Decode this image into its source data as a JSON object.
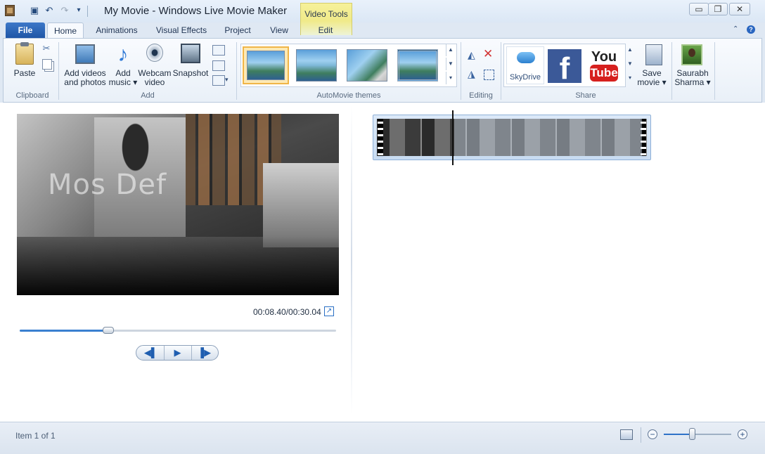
{
  "window": {
    "title": "My Movie - Windows Live Movie Maker",
    "contextual_tab_group": "Video Tools",
    "minimize_glyph": "▭",
    "restore_glyph": "❐",
    "close_glyph": "✕"
  },
  "quick_access": {
    "icons": [
      "app-icon",
      "save-icon",
      "undo-icon",
      "redo-icon",
      "customize-caret-icon"
    ],
    "save_glyph": "▣",
    "undo_glyph": "↶",
    "redo_glyph": "↷",
    "customize_glyph": "▾"
  },
  "tabs": [
    {
      "label": "File"
    },
    {
      "label": "Home"
    },
    {
      "label": "Animations"
    },
    {
      "label": "Visual Effects"
    },
    {
      "label": "Project"
    },
    {
      "label": "View"
    },
    {
      "label": "Edit"
    }
  ],
  "ribbon": {
    "clipboard": {
      "group_label": "Clipboard",
      "paste_label": "Paste",
      "cut_glyph": "✂"
    },
    "add": {
      "group_label": "Add",
      "add_videos_line1": "Add videos",
      "add_videos_line2": "and photos",
      "add_music_line1": "Add",
      "add_music_line2": "music ▾",
      "music_glyph": "♪",
      "webcam_line1": "Webcam",
      "webcam_line2": "video",
      "snapshot_label": "Snapshot",
      "caption_caret": "▾"
    },
    "themes": {
      "group_label": "AutoMovie themes",
      "count": 4,
      "selected_index": 0,
      "scroll_up": "▲",
      "scroll_down": "▼",
      "more": "▾"
    },
    "editing": {
      "group_label": "Editing",
      "rotate_left_glyph": "◭",
      "rotate_right_glyph": "◮",
      "remove_glyph": "✕"
    },
    "share": {
      "group_label": "Share",
      "skydrive_label": "SkyDrive",
      "facebook_glyph": "f",
      "youtube_you": "You",
      "youtube_tube": "Tube",
      "save_movie_line1": "Save",
      "save_movie_line2": "movie ▾",
      "user_line1": "Saurabh",
      "user_line2": "Sharma ▾",
      "scroll_up": "▲",
      "scroll_down": "▼",
      "more": "▾"
    }
  },
  "help": {
    "collapse_glyph": "⌃",
    "help_glyph": "?"
  },
  "preview": {
    "overlay_text": "Mos Def",
    "time": "00:08.40/00:30.04",
    "fullscreen_glyph": "↗",
    "progress_fraction": 0.28,
    "prev_glyph": "◀▌",
    "play_glyph": "▶",
    "next_glyph": "▐▶"
  },
  "storyboard": {
    "clip_count": 1,
    "playhead_fraction": 0.28
  },
  "status": {
    "item_text": "Item 1 of 1",
    "zoom_fraction": 0.42,
    "zoom_out_glyph": "−",
    "zoom_in_glyph": "+"
  },
  "colors": {
    "accent": "#3a80d0",
    "file_tab": "#2a62b4",
    "contextual_tab": "#f4ee92",
    "facebook": "#3b5998",
    "youtube": "#d6201e"
  }
}
